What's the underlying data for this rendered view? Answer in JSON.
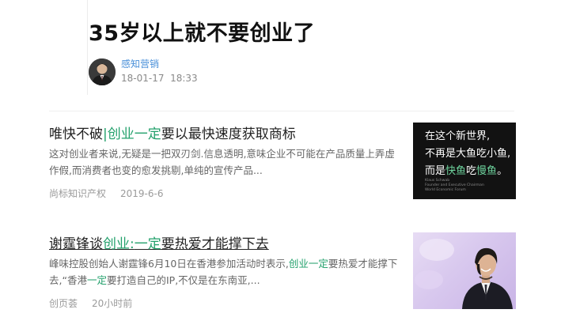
{
  "article": {
    "title": "35岁以上就不要创业了",
    "author": "感知营销",
    "date": "18-01-17",
    "time": "18:33"
  },
  "news": [
    {
      "title_parts": [
        "唯快不破",
        "|",
        "创业",
        "一定",
        "要以最快速度获取商标"
      ],
      "summary_text": "这对创业者来说,无疑是一把双刃剑.信息透明,意味企业不可能在产品质量上弄虚作假,而消费者也变的愈发挑剔,单纯的宣传产品...",
      "source": "尚标知识产权",
      "date": "2019-6-6",
      "thumb_lines": [
        "在这个新世界,",
        "不再是大鱼吃小鱼,",
        "而是",
        "快鱼",
        "吃",
        "慢鱼",
        "。"
      ],
      "thumb_caption": [
        "Klaus Schwab",
        "Founder and Executive Chairman",
        "World Economic Forum"
      ]
    },
    {
      "title_parts": [
        "谢霆锋谈",
        "创业",
        ":",
        "一定",
        "要热爱才能撑下去"
      ],
      "summary_parts": [
        "峰味控股创始人谢霆锋6月10日在香港参加活动时表示,",
        "创业",
        "一定",
        "要热爱才能撑下去,“香港",
        "一定",
        "要打造自己的IP,不仅是在东南亚,..."
      ],
      "source": "创页荟",
      "date": "20小时前"
    }
  ],
  "colors": {
    "highlight": "#22a06b",
    "author_link": "#4a90d9"
  }
}
